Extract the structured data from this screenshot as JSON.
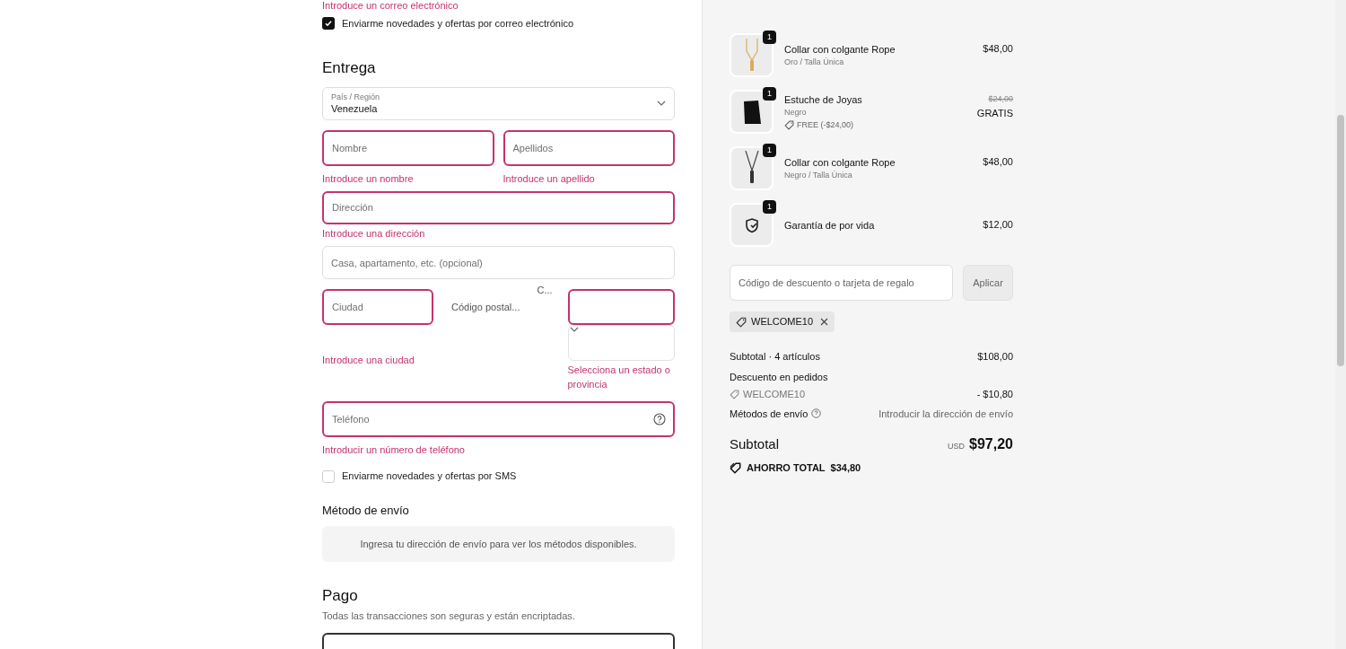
{
  "contact": {
    "error_text": "Introduce un correo electrónico",
    "newsletter": {
      "label": "Enviarme novedades y ofertas por correo electrónico",
      "checked": true
    }
  },
  "delivery": {
    "title": "Entrega",
    "country": {
      "label": "País / Región",
      "value": "Venezuela"
    },
    "first_name": {
      "placeholder": "Nombre",
      "error": true,
      "error_text": "Introduce un nombre"
    },
    "last_name": {
      "placeholder": "Apellidos",
      "error": true,
      "error_text": "Introduce un apellido"
    },
    "address": {
      "placeholder": "Dirección",
      "error": true,
      "error_text": "Introduce una dirección"
    },
    "address2": {
      "placeholder": "Casa, apartamento, etc. (opcional)",
      "error": false
    },
    "city": {
      "placeholder": "Ciudad",
      "error": true,
      "error_text": "Introduce una ciudad"
    },
    "postal_code": {
      "placeholder": "Código postal..."
    },
    "state": {
      "label": "C...",
      "error": true,
      "error_text": "Selecciona un estado o provincia"
    },
    "phone": {
      "placeholder": "Teléfono",
      "error": true,
      "error_text": "Introducir un número de teléfono"
    },
    "sms": {
      "label": "Enviarme novedades y ofertas por SMS",
      "checked": false
    }
  },
  "shipping": {
    "title": "Método de envío",
    "notice": "Ingresa tu dirección de envío para ver los métodos disponibles."
  },
  "payment": {
    "title": "Pago",
    "subtitle": "Todas las transacciones son seguras y están encriptadas."
  },
  "cart": {
    "items": [
      {
        "kind": "gold-necklace",
        "quantity": "1",
        "name": "Collar con colgante Rope",
        "variant": "Oro / Talla Única",
        "price": "$48,00"
      },
      {
        "kind": "pouch",
        "quantity": "1",
        "name": "Estuche de Joyas",
        "variant": "Negro",
        "discount": "FREE (-$24,00)",
        "original_price": "$24,00",
        "price": "GRATIS"
      },
      {
        "kind": "black-necklace",
        "quantity": "1",
        "name": "Collar con colgante Rope",
        "variant": "Negro / Talla Única",
        "price": "$48,00"
      },
      {
        "kind": "shield",
        "quantity": "1",
        "name": "Garantía de por vida",
        "price": "$12,00"
      }
    ],
    "discount_field": {
      "placeholder": "Código de descuento o tarjeta de regalo"
    },
    "apply_button": "Aplicar",
    "applied_code": "WELCOME10",
    "summary": {
      "subtotal_label": "Subtotal · 4 artículos",
      "subtotal_value": "$108,00",
      "order_discount_label": "Descuento en pedidos",
      "discount_code": "WELCOME10",
      "discount_value": "- $10,80",
      "shipping_label": "Métodos de envío",
      "shipping_value": "Introducir la dirección de envío",
      "total_label": "Subtotal",
      "currency": "USD",
      "total_value": "$97,20",
      "savings_label": "AHORRO TOTAL",
      "savings_value": "$34,80"
    }
  }
}
